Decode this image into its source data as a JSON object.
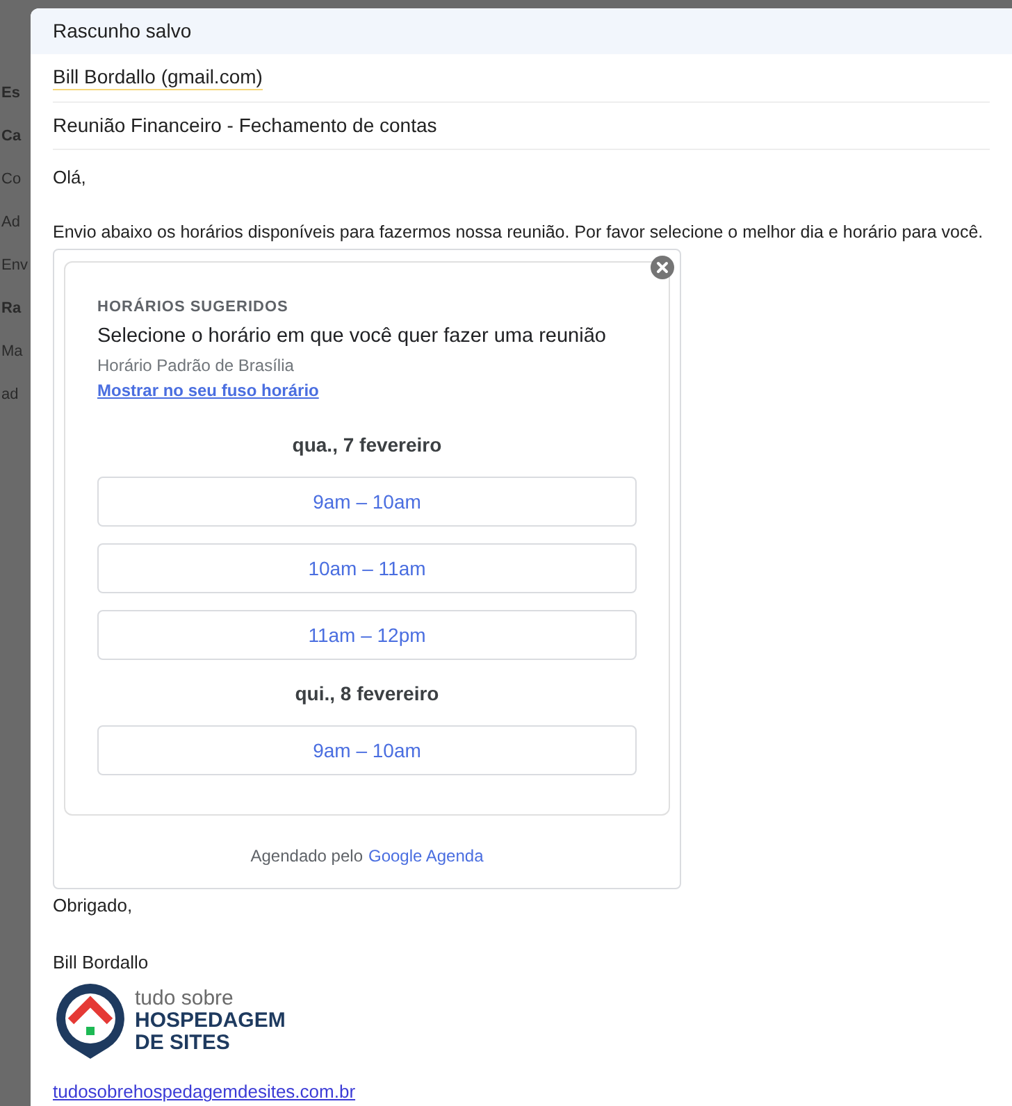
{
  "background": {
    "fragments": [
      {
        "text": "Es",
        "bold": true
      },
      {
        "text": "Ca",
        "bold": true
      },
      {
        "text": "Co",
        "bold": false
      },
      {
        "text": "Ad",
        "bold": false
      },
      {
        "text": "Env",
        "bold": false
      },
      {
        "text": "Ra",
        "bold": true
      },
      {
        "text": "Ma",
        "bold": false
      },
      {
        "text": "ad",
        "bold": false
      }
    ]
  },
  "compose": {
    "header_title": "Rascunho salvo",
    "to": "Bill Bordallo (gmail.com)",
    "subject": "Reunião Financeiro - Fechamento de contas",
    "greeting": "Olá,",
    "intro": "Envio abaixo os horários disponíveis para fazermos nossa reunião. Por favor selecione o melhor dia e horário para você.",
    "scheduler": {
      "eyebrow": "HORÁRIOS SUGERIDOS",
      "title": "Selecione o horário em que você quer fazer uma reunião",
      "timezone": "Horário Padrão de Brasília",
      "timezone_link": "Mostrar no seu fuso horário",
      "days": [
        {
          "date": "qua., 7 fevereiro",
          "slots": [
            "9am – 10am",
            "10am – 11am",
            "11am – 12pm"
          ]
        },
        {
          "date": "qui., 8 fevereiro",
          "slots": [
            "9am – 10am"
          ]
        }
      ],
      "footer_prefix": "Agendado pelo",
      "footer_link": "Google Agenda"
    },
    "closing": "Obrigado,",
    "signature_name": "Bill Bordallo",
    "logo": {
      "line1": "tudo sobre",
      "line2": "HOSPEDAGEM",
      "line3": "DE SITES"
    },
    "website": "tudosobrehospedagemdesites.com.br"
  }
}
